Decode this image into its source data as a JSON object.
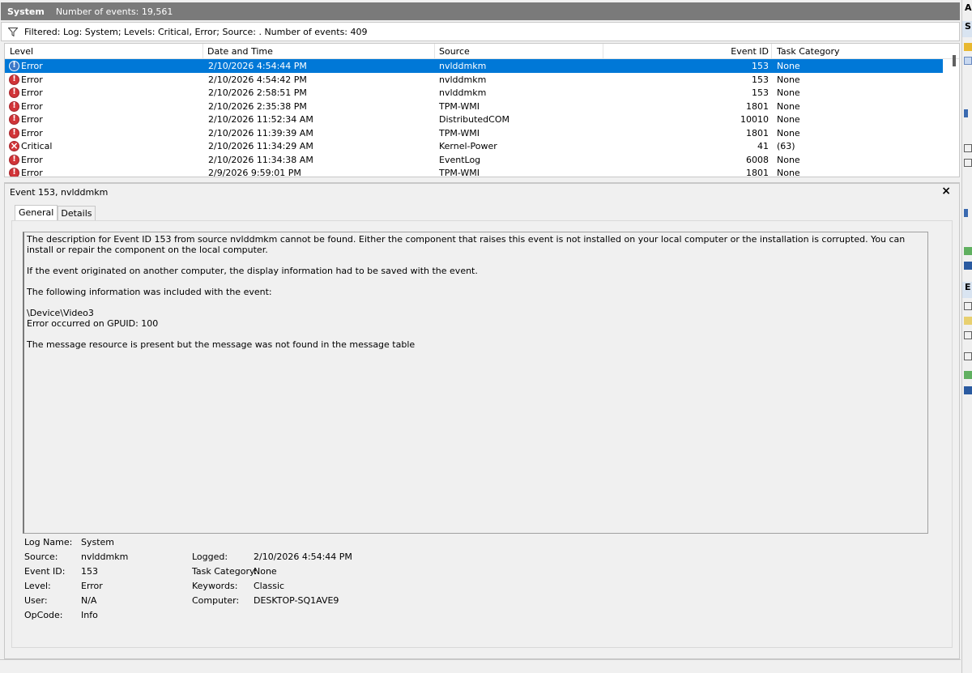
{
  "header": {
    "log_name": "System",
    "event_count_text": "Number of events: 19,561",
    "filter_text": "Filtered: Log: System; Levels: Critical, Error; Source: . Number of events: 409"
  },
  "columns": {
    "level": "Level",
    "date": "Date and Time",
    "source": "Source",
    "event_id": "Event ID",
    "task_category": "Task Category"
  },
  "events": [
    {
      "level": "Error",
      "icon": "error-icon",
      "date": "2/10/2026 4:54:44 PM",
      "source": "nvlddmkm",
      "event_id": "153",
      "task_category": "None",
      "selected": true
    },
    {
      "level": "Error",
      "icon": "error-icon",
      "date": "2/10/2026 4:54:42 PM",
      "source": "nvlddmkm",
      "event_id": "153",
      "task_category": "None"
    },
    {
      "level": "Error",
      "icon": "error-icon",
      "date": "2/10/2026 2:58:51 PM",
      "source": "nvlddmkm",
      "event_id": "153",
      "task_category": "None"
    },
    {
      "level": "Error",
      "icon": "error-icon",
      "date": "2/10/2026 2:35:38 PM",
      "source": "TPM-WMI",
      "event_id": "1801",
      "task_category": "None"
    },
    {
      "level": "Error",
      "icon": "error-icon",
      "date": "2/10/2026 11:52:34 AM",
      "source": "DistributedCOM",
      "event_id": "10010",
      "task_category": "None"
    },
    {
      "level": "Error",
      "icon": "error-icon",
      "date": "2/10/2026 11:39:39 AM",
      "source": "TPM-WMI",
      "event_id": "1801",
      "task_category": "None"
    },
    {
      "level": "Critical",
      "icon": "critical-icon",
      "date": "2/10/2026 11:34:29 AM",
      "source": "Kernel-Power",
      "event_id": "41",
      "task_category": "(63)"
    },
    {
      "level": "Error",
      "icon": "error-icon",
      "date": "2/10/2026 11:34:38 AM",
      "source": "EventLog",
      "event_id": "6008",
      "task_category": "None"
    },
    {
      "level": "Error",
      "icon": "error-icon",
      "date": "2/9/2026 9:59:01 PM",
      "source": "TPM-WMI",
      "event_id": "1801",
      "task_category": "None"
    }
  ],
  "detail": {
    "title": "Event 153, nvlddmkm",
    "close": "×",
    "tabs": [
      "General",
      "Details"
    ],
    "description": {
      "p1": "The description for Event ID 153 from source nvlddmkm cannot be found. Either the component that raises this event is not installed on your local computer or the installation is corrupted. You can install or repair the component on the local computer.",
      "p2": "If the event originated on another computer, the display information had to be saved with the event.",
      "p3": "The following information was included with the event:",
      "p4a": "\\Device\\Video3",
      "p4b": "Error occurred on GPUID: 100",
      "p5": "The message resource is present but the message was not found in the message table"
    },
    "properties": {
      "log_name_label": "Log Name:",
      "log_name": "System",
      "source_label": "Source:",
      "source": "nvlddmkm",
      "event_id_label": "Event ID:",
      "event_id": "153",
      "level_label": "Level:",
      "level": "Error",
      "user_label": "User:",
      "user": "N/A",
      "opcode_label": "OpCode:",
      "opcode": "Info",
      "logged_label": "Logged:",
      "logged": "2/10/2026 4:54:44 PM",
      "task_category_label": "Task Category:",
      "task_category": "None",
      "keywords_label": "Keywords:",
      "keywords": "Classic",
      "computer_label": "Computer:",
      "computer": "DESKTOP-SQ1AVE9"
    }
  },
  "actions_pane": {
    "header_a": "A",
    "header_s": "S",
    "header_e": "E"
  },
  "colors": {
    "selection": "#0078d7",
    "error": "#d13438",
    "titlebar": "#7a7a7a"
  }
}
